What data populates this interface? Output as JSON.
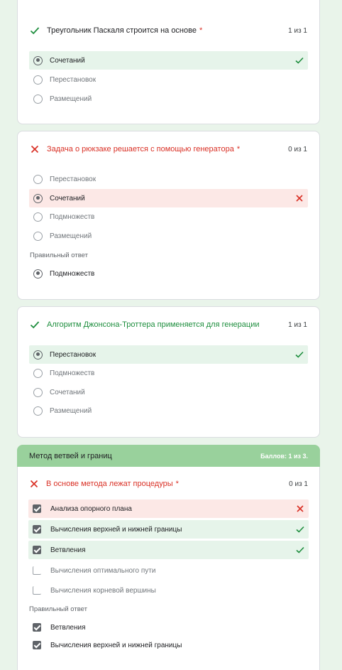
{
  "colors": {
    "correct": "#1e8e3e",
    "incorrect": "#d93025",
    "section": "#99d19c"
  },
  "q1": {
    "title": "Треугольник Паскаля строится на основе",
    "required": "*",
    "score": "1 из 1",
    "options": [
      "Сочетаний",
      "Перестановок",
      "Размещений"
    ]
  },
  "q2": {
    "title": "Задача о рюкзаке решается с помощью генератора",
    "required": "*",
    "score": "0 из 1",
    "options": [
      "Перестановок",
      "Сочетаний",
      "Подмножеств",
      "Размещений"
    ],
    "correct_label": "Правильный ответ",
    "correct_answer": "Подмножеств"
  },
  "q3": {
    "title": "Алгоритм Джонсона-Троттера применяется для генерации",
    "score": "1 из 1",
    "options": [
      "Перестановок",
      "Подмножеств",
      "Сочетаний",
      "Размещений"
    ]
  },
  "section": {
    "title": "Метод ветвей и границ",
    "score": "Баллов: 1 из 3."
  },
  "q4": {
    "title": "В основе метода лежат процедуры",
    "required": "*",
    "score": "0 из 1",
    "options": [
      "Анализа опорного плана",
      "Вычисления верхней и нижней границы",
      "Ветвления",
      "Вычисления оптимального пути",
      "Вычисления корневой вершины"
    ],
    "correct_label": "Правильный ответ",
    "correct_answers": [
      "Ветвления",
      "Вычисления верхней и нижней границы"
    ]
  }
}
